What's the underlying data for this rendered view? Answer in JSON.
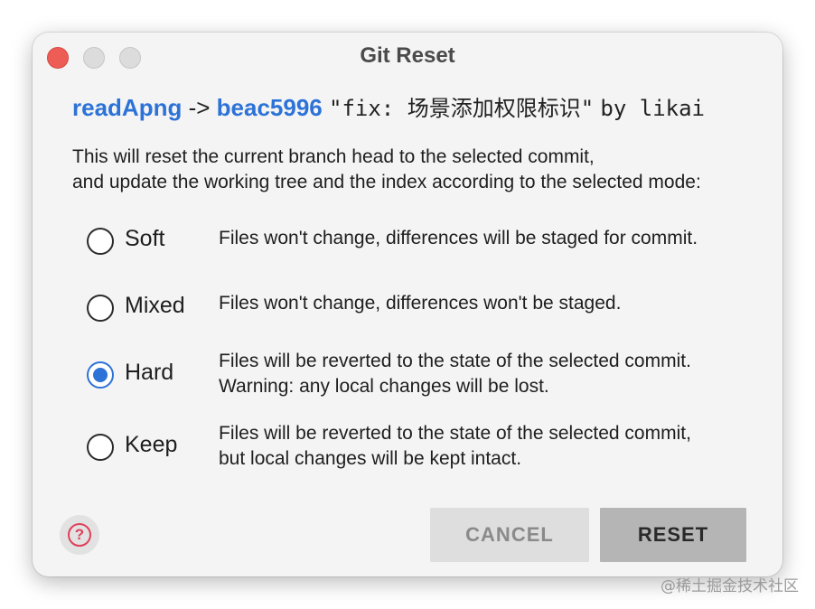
{
  "window": {
    "title": "Git Reset"
  },
  "commit": {
    "branch": "readApng",
    "arrow": "->",
    "hash": "beac5996",
    "message": "\"fix: 场景添加权限标识\"",
    "by": "by likai"
  },
  "description": {
    "line1": "This will reset the current branch head to the selected commit,",
    "line2": "and update the working tree and the index according to the selected mode:"
  },
  "modes": [
    {
      "label": "Soft",
      "checked": false,
      "desc1": "Files won't change, differences will be staged for commit.",
      "desc2": ""
    },
    {
      "label": "Mixed",
      "checked": false,
      "desc1": "Files won't change, differences won't be staged.",
      "desc2": ""
    },
    {
      "label": "Hard",
      "checked": true,
      "desc1": "Files will be reverted to the state of the selected commit.",
      "desc2": "Warning: any local changes will be lost."
    },
    {
      "label": "Keep",
      "checked": false,
      "desc1": "Files will be reverted to the state of the selected commit,",
      "desc2": "but local changes will be kept intact."
    }
  ],
  "buttons": {
    "help": "?",
    "cancel": "CANCEL",
    "reset": "RESET"
  },
  "watermark": "@稀土掘金技术社区",
  "colors": {
    "accent": "#2d73d7",
    "close": "#ee5d55",
    "help": "#e0405a"
  }
}
